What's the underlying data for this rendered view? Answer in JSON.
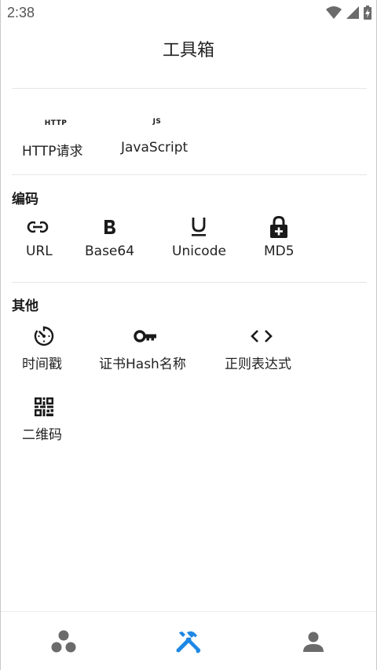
{
  "status_bar": {
    "time": "2:38",
    "icons": [
      "wifi-icon",
      "signal-icon",
      "battery-charging-icon"
    ]
  },
  "header": {
    "title": "工具箱"
  },
  "sections": {
    "network": {
      "items": [
        {
          "badge": "HTTP",
          "label": "HTTP请求"
        },
        {
          "badge": "JS",
          "label": "JavaScript"
        }
      ]
    },
    "encoding": {
      "title": "编码",
      "items": [
        {
          "icon": "link-icon",
          "label": "URL"
        },
        {
          "icon": "bold-b-icon",
          "label": "Base64"
        },
        {
          "icon": "underline-u-icon",
          "label": "Unicode"
        },
        {
          "icon": "lock-plus-icon",
          "label": "MD5"
        }
      ]
    },
    "other": {
      "title": "其他",
      "items": [
        {
          "icon": "timer-icon",
          "label": "时间戳"
        },
        {
          "icon": "key-icon",
          "label": "证书Hash名称"
        },
        {
          "icon": "code-brackets-icon",
          "label": "正则表达式"
        },
        {
          "icon": "qr-code-icon",
          "label": "二维码"
        }
      ]
    }
  },
  "bottom_nav": {
    "items": [
      {
        "icon": "bubbles-icon",
        "active": false
      },
      {
        "icon": "tools-icon",
        "active": true
      },
      {
        "icon": "person-icon",
        "active": false
      }
    ],
    "active_color": "#1e88e5",
    "inactive_color": "#6b6b6b"
  }
}
